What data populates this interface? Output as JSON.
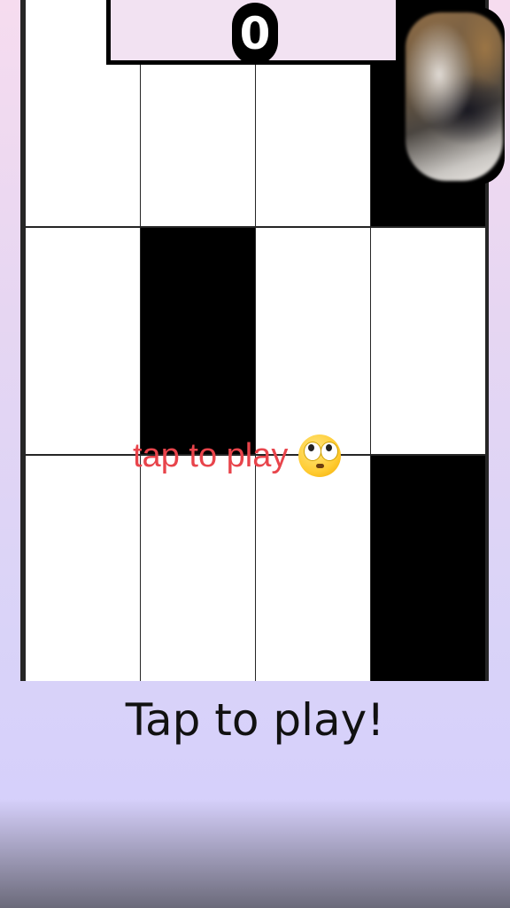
{
  "header": {
    "score": "0"
  },
  "board": {
    "columns": 4,
    "rows": [
      [
        "white",
        "white",
        "white",
        "black"
      ],
      [
        "white",
        "black",
        "white",
        "white"
      ],
      [
        "white",
        "white",
        "white",
        "black"
      ]
    ]
  },
  "overlay": {
    "tap_label": "tap to play",
    "emoji": "flushed-face-icon",
    "tap_color": "#e8444b"
  },
  "footer": {
    "caption": "Tap to play!"
  },
  "colors": {
    "tile_white": "#ffffff",
    "tile_black": "#000000",
    "score_bg": "#f2e2f2"
  }
}
